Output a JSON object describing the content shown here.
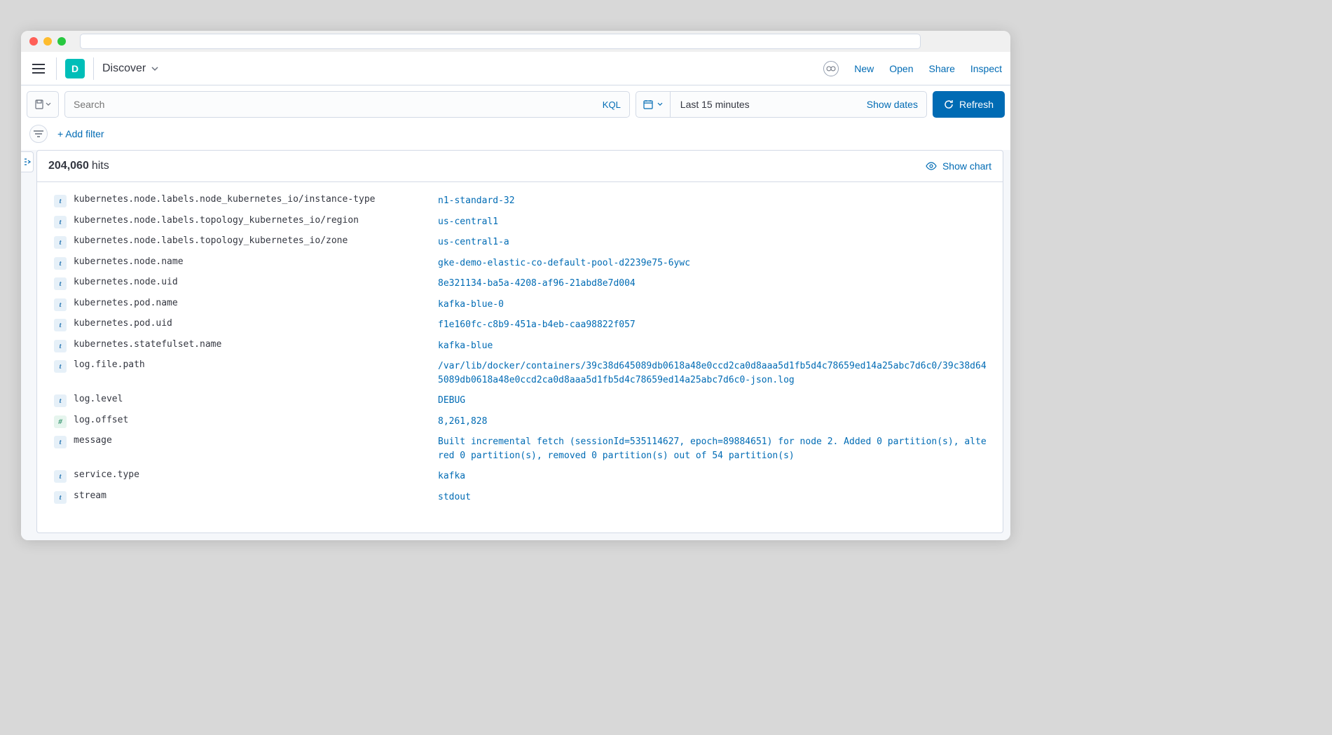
{
  "app": {
    "badge_letter": "D",
    "name": "Discover"
  },
  "header_links": {
    "new": "New",
    "open": "Open",
    "share": "Share",
    "inspect": "Inspect"
  },
  "query": {
    "placeholder": "Search",
    "kql_label": "KQL"
  },
  "date": {
    "range_text": "Last 15 minutes",
    "show_dates": "Show dates"
  },
  "refresh_label": "Refresh",
  "filters": {
    "add_filter": "+ Add filter"
  },
  "hits": {
    "count": "204,060",
    "label": "hits",
    "show_chart": "Show chart"
  },
  "fields": [
    {
      "type": "t",
      "name": "kubernetes.node.labels.node_kubernetes_io/instance-type",
      "value": "n1-standard-32"
    },
    {
      "type": "t",
      "name": "kubernetes.node.labels.topology_kubernetes_io/region",
      "value": "us-central1"
    },
    {
      "type": "t",
      "name": "kubernetes.node.labels.topology_kubernetes_io/zone",
      "value": "us-central1-a"
    },
    {
      "type": "t",
      "name": "kubernetes.node.name",
      "value": "gke-demo-elastic-co-default-pool-d2239e75-6ywc"
    },
    {
      "type": "t",
      "name": "kubernetes.node.uid",
      "value": "8e321134-ba5a-4208-af96-21abd8e7d004"
    },
    {
      "type": "t",
      "name": "kubernetes.pod.name",
      "value": "kafka-blue-0"
    },
    {
      "type": "t",
      "name": "kubernetes.pod.uid",
      "value": "f1e160fc-c8b9-451a-b4eb-caa98822f057"
    },
    {
      "type": "t",
      "name": "kubernetes.statefulset.name",
      "value": "kafka-blue"
    },
    {
      "type": "t",
      "name": "log.file.path",
      "value": "/var/lib/docker/containers/39c38d645089db0618a48e0ccd2ca0d8aaa5d1fb5d4c78659ed14a25abc7d6c0/39c38d645089db0618a48e0ccd2ca0d8aaa5d1fb5d4c78659ed14a25abc7d6c0-json.log"
    },
    {
      "type": "t",
      "name": "log.level",
      "value": "DEBUG"
    },
    {
      "type": "n",
      "name": "log.offset",
      "value": "8,261,828"
    },
    {
      "type": "t",
      "name": "message",
      "value": "Built incremental fetch (sessionId=535114627, epoch=89884651) for node 2. Added 0 partition(s), altered 0 partition(s), removed 0 partition(s) out of 54 partition(s)"
    },
    {
      "type": "t",
      "name": "service.type",
      "value": "kafka"
    },
    {
      "type": "t",
      "name": "stream",
      "value": "stdout"
    }
  ]
}
